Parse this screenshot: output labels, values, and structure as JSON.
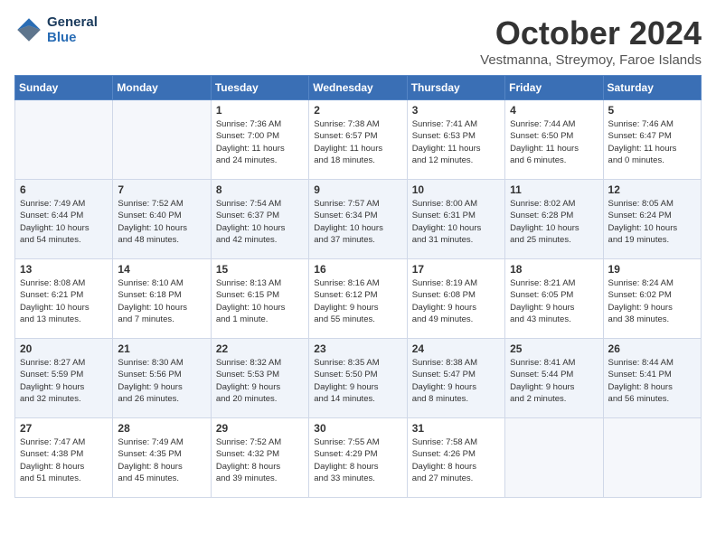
{
  "header": {
    "logo_line1": "General",
    "logo_line2": "Blue",
    "month_title": "October 2024",
    "subtitle": "Vestmanna, Streymoy, Faroe Islands"
  },
  "weekdays": [
    "Sunday",
    "Monday",
    "Tuesday",
    "Wednesday",
    "Thursday",
    "Friday",
    "Saturday"
  ],
  "weeks": [
    [
      {
        "day": "",
        "info": ""
      },
      {
        "day": "",
        "info": ""
      },
      {
        "day": "1",
        "info": "Sunrise: 7:36 AM\nSunset: 7:00 PM\nDaylight: 11 hours\nand 24 minutes."
      },
      {
        "day": "2",
        "info": "Sunrise: 7:38 AM\nSunset: 6:57 PM\nDaylight: 11 hours\nand 18 minutes."
      },
      {
        "day": "3",
        "info": "Sunrise: 7:41 AM\nSunset: 6:53 PM\nDaylight: 11 hours\nand 12 minutes."
      },
      {
        "day": "4",
        "info": "Sunrise: 7:44 AM\nSunset: 6:50 PM\nDaylight: 11 hours\nand 6 minutes."
      },
      {
        "day": "5",
        "info": "Sunrise: 7:46 AM\nSunset: 6:47 PM\nDaylight: 11 hours\nand 0 minutes."
      }
    ],
    [
      {
        "day": "6",
        "info": "Sunrise: 7:49 AM\nSunset: 6:44 PM\nDaylight: 10 hours\nand 54 minutes."
      },
      {
        "day": "7",
        "info": "Sunrise: 7:52 AM\nSunset: 6:40 PM\nDaylight: 10 hours\nand 48 minutes."
      },
      {
        "day": "8",
        "info": "Sunrise: 7:54 AM\nSunset: 6:37 PM\nDaylight: 10 hours\nand 42 minutes."
      },
      {
        "day": "9",
        "info": "Sunrise: 7:57 AM\nSunset: 6:34 PM\nDaylight: 10 hours\nand 37 minutes."
      },
      {
        "day": "10",
        "info": "Sunrise: 8:00 AM\nSunset: 6:31 PM\nDaylight: 10 hours\nand 31 minutes."
      },
      {
        "day": "11",
        "info": "Sunrise: 8:02 AM\nSunset: 6:28 PM\nDaylight: 10 hours\nand 25 minutes."
      },
      {
        "day": "12",
        "info": "Sunrise: 8:05 AM\nSunset: 6:24 PM\nDaylight: 10 hours\nand 19 minutes."
      }
    ],
    [
      {
        "day": "13",
        "info": "Sunrise: 8:08 AM\nSunset: 6:21 PM\nDaylight: 10 hours\nand 13 minutes."
      },
      {
        "day": "14",
        "info": "Sunrise: 8:10 AM\nSunset: 6:18 PM\nDaylight: 10 hours\nand 7 minutes."
      },
      {
        "day": "15",
        "info": "Sunrise: 8:13 AM\nSunset: 6:15 PM\nDaylight: 10 hours\nand 1 minute."
      },
      {
        "day": "16",
        "info": "Sunrise: 8:16 AM\nSunset: 6:12 PM\nDaylight: 9 hours\nand 55 minutes."
      },
      {
        "day": "17",
        "info": "Sunrise: 8:19 AM\nSunset: 6:08 PM\nDaylight: 9 hours\nand 49 minutes."
      },
      {
        "day": "18",
        "info": "Sunrise: 8:21 AM\nSunset: 6:05 PM\nDaylight: 9 hours\nand 43 minutes."
      },
      {
        "day": "19",
        "info": "Sunrise: 8:24 AM\nSunset: 6:02 PM\nDaylight: 9 hours\nand 38 minutes."
      }
    ],
    [
      {
        "day": "20",
        "info": "Sunrise: 8:27 AM\nSunset: 5:59 PM\nDaylight: 9 hours\nand 32 minutes."
      },
      {
        "day": "21",
        "info": "Sunrise: 8:30 AM\nSunset: 5:56 PM\nDaylight: 9 hours\nand 26 minutes."
      },
      {
        "day": "22",
        "info": "Sunrise: 8:32 AM\nSunset: 5:53 PM\nDaylight: 9 hours\nand 20 minutes."
      },
      {
        "day": "23",
        "info": "Sunrise: 8:35 AM\nSunset: 5:50 PM\nDaylight: 9 hours\nand 14 minutes."
      },
      {
        "day": "24",
        "info": "Sunrise: 8:38 AM\nSunset: 5:47 PM\nDaylight: 9 hours\nand 8 minutes."
      },
      {
        "day": "25",
        "info": "Sunrise: 8:41 AM\nSunset: 5:44 PM\nDaylight: 9 hours\nand 2 minutes."
      },
      {
        "day": "26",
        "info": "Sunrise: 8:44 AM\nSunset: 5:41 PM\nDaylight: 8 hours\nand 56 minutes."
      }
    ],
    [
      {
        "day": "27",
        "info": "Sunrise: 7:47 AM\nSunset: 4:38 PM\nDaylight: 8 hours\nand 51 minutes."
      },
      {
        "day": "28",
        "info": "Sunrise: 7:49 AM\nSunset: 4:35 PM\nDaylight: 8 hours\nand 45 minutes."
      },
      {
        "day": "29",
        "info": "Sunrise: 7:52 AM\nSunset: 4:32 PM\nDaylight: 8 hours\nand 39 minutes."
      },
      {
        "day": "30",
        "info": "Sunrise: 7:55 AM\nSunset: 4:29 PM\nDaylight: 8 hours\nand 33 minutes."
      },
      {
        "day": "31",
        "info": "Sunrise: 7:58 AM\nSunset: 4:26 PM\nDaylight: 8 hours\nand 27 minutes."
      },
      {
        "day": "",
        "info": ""
      },
      {
        "day": "",
        "info": ""
      }
    ]
  ]
}
